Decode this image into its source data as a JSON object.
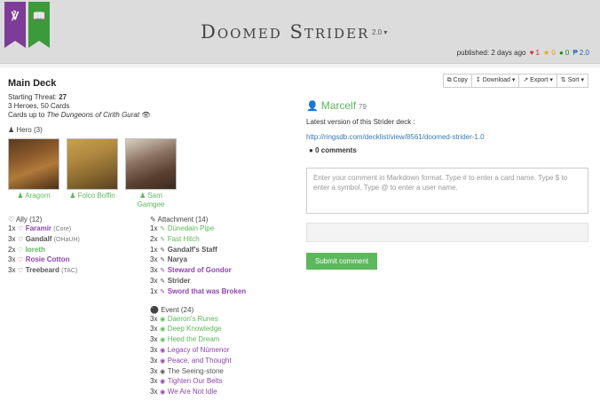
{
  "header": {
    "title": "Doomed Strider",
    "version": "2.0",
    "published_label": "published: 2 days ago",
    "likes": "1",
    "favorites": "0",
    "comments": "0",
    "version_badge": "2.0"
  },
  "deck": {
    "heading": "Main Deck",
    "threat_label": "Starting Threat: ",
    "threat_value": "27",
    "summary": "3 Heroes, 50 Cards",
    "cards_up_to_label": "Cards up to ",
    "cards_up_to_value": "The Dungeons of Cirith Gurat",
    "hero_section": "Hero (3)",
    "heroes": [
      {
        "name": "Aragorn"
      },
      {
        "name": "Folco Boffin"
      },
      {
        "name": "Sam Gamgee"
      }
    ],
    "ally_section": "Ally (12)",
    "allies": [
      {
        "qty": "1x",
        "name": "Faramir",
        "set": "(Core)"
      },
      {
        "qty": "3x",
        "name": "Gandalf",
        "set": "(OHaUH)"
      },
      {
        "qty": "2x",
        "name": "Ioreth",
        "set": ""
      },
      {
        "qty": "3x",
        "name": "Rosie Cotton",
        "set": ""
      },
      {
        "qty": "3x",
        "name": "Treebeard",
        "set": "(TAC)"
      }
    ],
    "attachment_section": "Attachment (14)",
    "attachments": [
      {
        "qty": "1x",
        "name": "Dúnedain Pipe"
      },
      {
        "qty": "2x",
        "name": "Fast Hitch"
      },
      {
        "qty": "1x",
        "name": "Gandalf's Staff"
      },
      {
        "qty": "3x",
        "name": "Narya"
      },
      {
        "qty": "3x",
        "name": "Steward of Gondor"
      },
      {
        "qty": "3x",
        "name": "Strider"
      },
      {
        "qty": "1x",
        "name": "Sword that was Broken"
      }
    ],
    "event_section": "Event (24)",
    "events": [
      {
        "qty": "3x",
        "name": "Daeron's Runes"
      },
      {
        "qty": "3x",
        "name": "Deep Knowledge"
      },
      {
        "qty": "3x",
        "name": "Heed the Dream"
      },
      {
        "qty": "3x",
        "name": "Legacy of Númenor"
      },
      {
        "qty": "3x",
        "name": "Peace, and Thought"
      },
      {
        "qty": "3x",
        "name": "The Seeing-stone"
      },
      {
        "qty": "3x",
        "name": "Tighten Our Belts"
      },
      {
        "qty": "3x",
        "name": "We Are Not Idle"
      }
    ]
  },
  "toolbar": {
    "copy": "Copy",
    "download": "Download",
    "export": "Export",
    "sort": "Sort"
  },
  "author": {
    "name": "Marcelf",
    "reputation": "79"
  },
  "description": {
    "latest_text": "Latest version of this Strider deck :",
    "link": "http://ringsdb.com/decklist/view/8561/doomed-strider-1.0"
  },
  "comments": {
    "heading": "0 comments",
    "placeholder": "Enter your comment in Markdown format. Type # to enter a card name. Type $ to enter a symbol. Type @ to enter a user name.",
    "submit": "Submit comment"
  },
  "colors": {
    "leadership": "#8e44ad",
    "lore": "#5cb85c",
    "accent_green": "#5cb85c",
    "link": "#337ab7"
  }
}
